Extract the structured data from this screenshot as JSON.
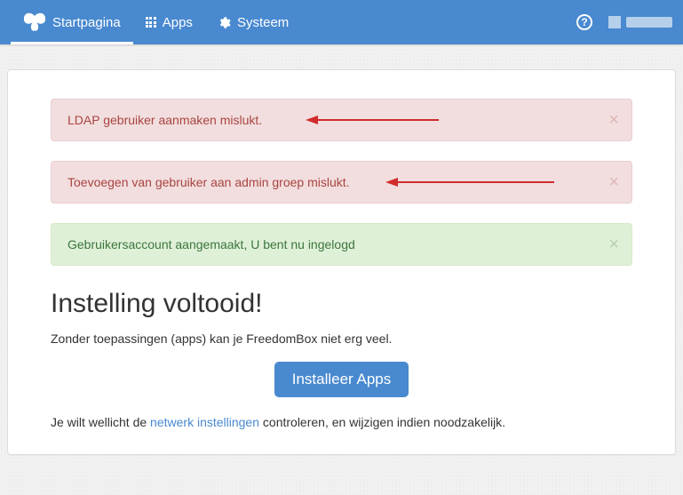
{
  "nav": {
    "home": "Startpagina",
    "apps": "Apps",
    "system": "Systeem"
  },
  "alerts": {
    "ldap_fail": "LDAP gebruiker aanmaken mislukt.",
    "admin_group_fail": "Toevoegen van gebruiker aan admin groep mislukt.",
    "account_created": "Gebruikersaccount aangemaakt, U bent nu ingelogd"
  },
  "heading": "Instelling voltooid!",
  "subtext": "Zonder toepassingen (apps) kan je FreedomBox niet erg veel.",
  "install_button": "Installeer Apps",
  "hint_prefix": "Je wilt wellicht de ",
  "hint_link": "netwerk instellingen",
  "hint_suffix": " controleren, en wijzigen indien noodzakelijk."
}
